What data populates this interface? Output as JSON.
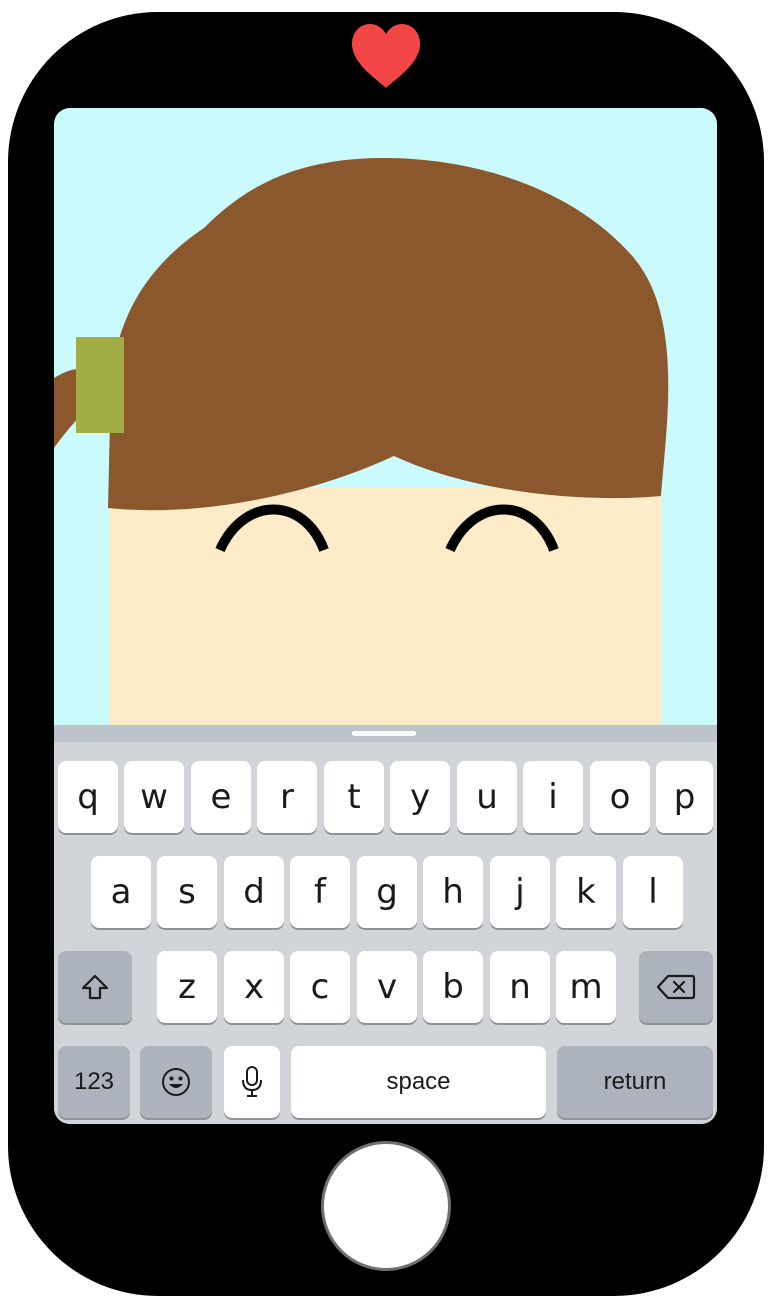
{
  "device": {
    "frame_color": "#000000",
    "notch_icon": "heart-icon",
    "heart_color": "#f34747"
  },
  "scene": {
    "background_color": "#cbfafd",
    "hair_color": "#8b572d",
    "face_color": "#feebc8",
    "hair_clip_color": "#a3ad45",
    "eye_color": "#000000"
  },
  "keyboard": {
    "row1": [
      "q",
      "w",
      "e",
      "r",
      "t",
      "y",
      "u",
      "i",
      "o",
      "p"
    ],
    "row2": [
      "a",
      "s",
      "d",
      "f",
      "g",
      "h",
      "j",
      "k",
      "l"
    ],
    "row3": [
      "z",
      "x",
      "c",
      "v",
      "b",
      "n",
      "m"
    ],
    "shift_icon": "shift-icon",
    "backspace_icon": "backspace-icon",
    "numbers_label": "123",
    "emoji_icon": "emoji-icon",
    "mic_icon": "microphone-icon",
    "space_label": "space",
    "return_label": "return",
    "key_color": "#ffffff",
    "dark_key_color": "#adb3bc",
    "background_color": "#d1d4d9"
  }
}
